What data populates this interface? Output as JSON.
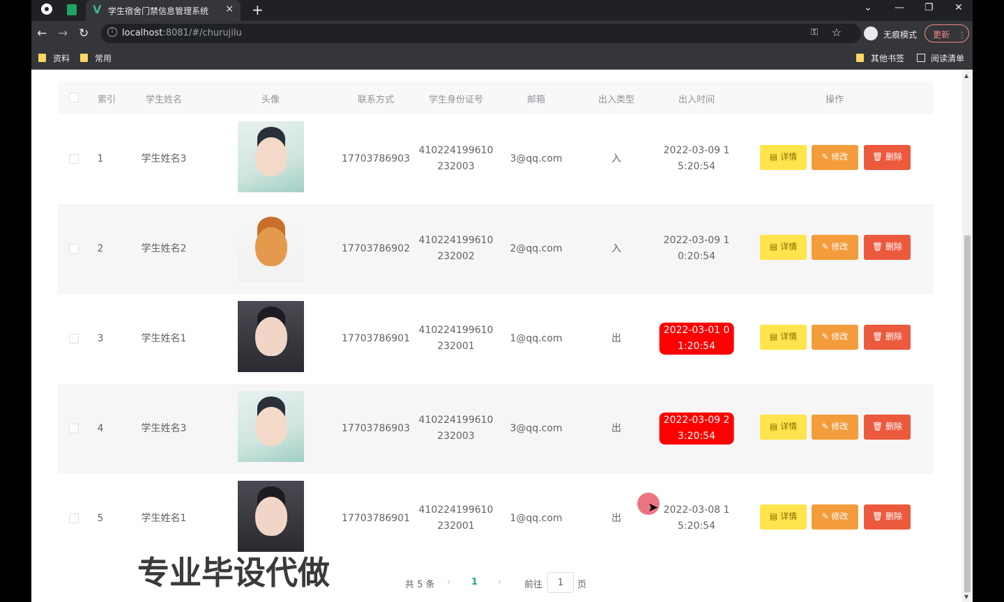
{
  "browser": {
    "tab_title": "学生宿舍门禁信息管理系统",
    "tab_close": "×",
    "new_tab": "+",
    "url_host": "localhost",
    "url_path": ":8081/#/churujilu",
    "incognito_label": "无痕模式",
    "update_label": "更新",
    "bookmarks": [
      "资料",
      "常用"
    ],
    "other_bookmarks": "其他书签",
    "reading_list": "阅读清单"
  },
  "table": {
    "headers": [
      "索引",
      "学生姓名",
      "头像",
      "联系方式",
      "学生身份证号",
      "邮箱",
      "出入类型",
      "出入时间",
      "操作"
    ],
    "rows": [
      {
        "index": "1",
        "name": "学生姓名3",
        "phone": "17703786903",
        "id_line1": "410224199610",
        "id_line2": "232003",
        "email": "3@qq.com",
        "type": "入",
        "time_line1": "2022-03-09 1",
        "time_line2": "5:20:54",
        "highlight": false,
        "avatar": "girl-traditional"
      },
      {
        "index": "2",
        "name": "学生姓名2",
        "phone": "17703786902",
        "id_line1": "410224199610",
        "id_line2": "232002",
        "email": "2@qq.com",
        "type": "入",
        "time_line1": "2022-03-09 1",
        "time_line2": "0:20:54",
        "highlight": false,
        "avatar": "shiba-dog"
      },
      {
        "index": "3",
        "name": "学生姓名1",
        "phone": "17703786901",
        "id_line1": "410224199610",
        "id_line2": "232001",
        "email": "1@qq.com",
        "type": "出",
        "time_line1": "2022-03-01 0",
        "time_line2": "1:20:54",
        "highlight": true,
        "avatar": "girl-dark-hair"
      },
      {
        "index": "4",
        "name": "学生姓名3",
        "phone": "17703786903",
        "id_line1": "410224199610",
        "id_line2": "232003",
        "email": "3@qq.com",
        "type": "出",
        "time_line1": "2022-03-09 2",
        "time_line2": "3:20:54",
        "highlight": true,
        "avatar": "girl-traditional"
      },
      {
        "index": "5",
        "name": "学生姓名1",
        "phone": "17703786901",
        "id_line1": "410224199610",
        "id_line2": "232001",
        "email": "1@qq.com",
        "type": "出",
        "time_line1": "2022-03-08 1",
        "time_line2": "5:20:54",
        "highlight": false,
        "avatar": "girl-dark-hair"
      }
    ],
    "actions": {
      "detail": "详情",
      "edit": "修改",
      "delete": "删除"
    }
  },
  "pagination": {
    "total": "共 5 条",
    "prev": "‹",
    "current": "1",
    "next": "›",
    "goto_label": "前往",
    "goto_value": "1",
    "page_suffix": "页"
  },
  "watermark": "专业毕设代做",
  "colors": {
    "highlight_time": "#ff0000",
    "btn_detail": "#ffe44d",
    "btn_edit": "#f39c3c",
    "btn_delete": "#ec5a3e",
    "active_page": "#1ba784"
  }
}
